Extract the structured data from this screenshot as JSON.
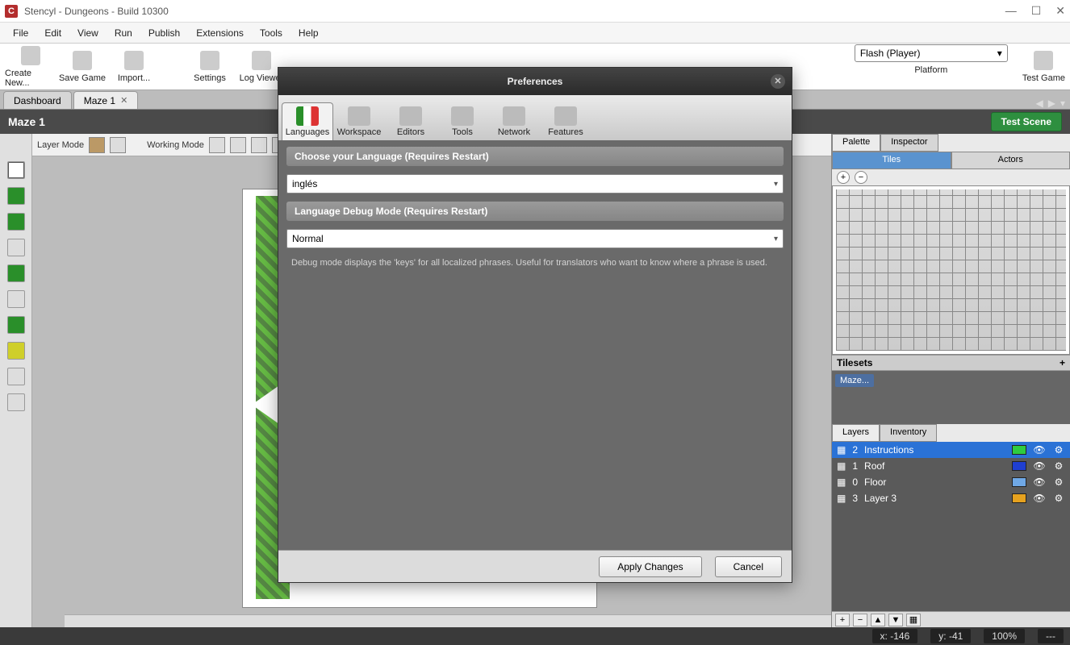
{
  "window": {
    "title": "Stencyl - Dungeons - Build 10300"
  },
  "menu": {
    "items": [
      "File",
      "Edit",
      "View",
      "Run",
      "Publish",
      "Extensions",
      "Tools",
      "Help"
    ]
  },
  "toolbar": {
    "buttons": [
      {
        "label": "Create New...",
        "icon": "plus-icon"
      },
      {
        "label": "Save Game",
        "icon": "disk-icon"
      },
      {
        "label": "Import...",
        "icon": "import-icon"
      }
    ],
    "centerButtons": [
      {
        "label": "Settings",
        "icon": "settings-icon"
      },
      {
        "label": "Log Viewer",
        "icon": "log-icon"
      }
    ],
    "platform_label": "Platform",
    "platform_value": "Flash (Player)",
    "test_label": "Test Game"
  },
  "tabs": {
    "items": [
      {
        "label": "Dashboard",
        "active": false,
        "closable": false
      },
      {
        "label": "Maze 1",
        "active": true,
        "closable": true
      }
    ]
  },
  "scene": {
    "title": "Maze 1",
    "test_scene": "Test Scene"
  },
  "mode_bar": {
    "layer_mode": "Layer Mode",
    "working_mode": "Working Mode"
  },
  "right": {
    "tabs": {
      "palette": "Palette",
      "inspector": "Inspector"
    },
    "sub": {
      "tiles": "Tiles",
      "actors": "Actors"
    },
    "tilesets_head": "Tilesets",
    "tileset_chip": "Maze...",
    "layers_tabs": {
      "layers": "Layers",
      "inventory": "Inventory"
    },
    "layers": [
      {
        "num": "2",
        "name": "Instructions",
        "color": "#2ecc40",
        "selected": true
      },
      {
        "num": "1",
        "name": "Roof",
        "color": "#1f3fd1",
        "selected": false
      },
      {
        "num": "0",
        "name": "Floor",
        "color": "#6fa8e6",
        "selected": false
      },
      {
        "num": "3",
        "name": "Layer 3",
        "color": "#e6a21f",
        "selected": false
      }
    ]
  },
  "status": {
    "x_label": "x:",
    "x_val": "-146",
    "y_label": "y:",
    "y_val": "-41",
    "zoom": "100%",
    "extra": "---"
  },
  "modal": {
    "title": "Preferences",
    "tabs": [
      {
        "label": "Languages",
        "icon": "flag-icon",
        "active": true
      },
      {
        "label": "Workspace",
        "icon": "monitor-icon"
      },
      {
        "label": "Editors",
        "icon": "grid-icon"
      },
      {
        "label": "Tools",
        "icon": "wrench-icon"
      },
      {
        "label": "Network",
        "icon": "network-icon"
      },
      {
        "label": "Features",
        "icon": "box-icon"
      }
    ],
    "section1": {
      "head": "Choose your Language (Requires Restart)",
      "value": "inglés"
    },
    "section2": {
      "head": "Language Debug Mode (Requires Restart)",
      "value": "Normal",
      "hint": "Debug mode displays the 'keys' for all localized phrases. Useful for translators who want to know where a phrase is used."
    },
    "apply": "Apply Changes",
    "cancel": "Cancel"
  }
}
